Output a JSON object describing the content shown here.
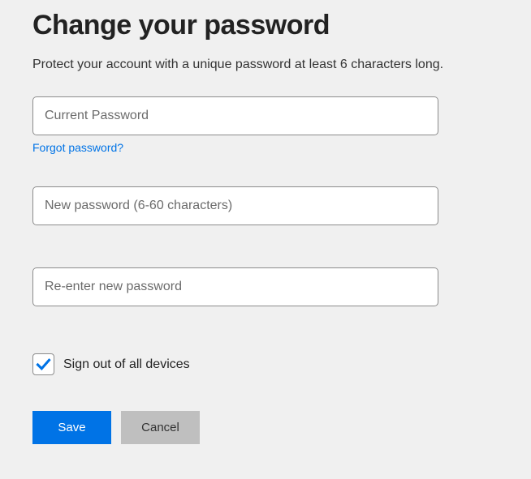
{
  "header": {
    "title": "Change your password",
    "subtitle": "Protect your account with a unique password at least 6 characters long."
  },
  "form": {
    "current_password": {
      "placeholder": "Current Password",
      "value": ""
    },
    "forgot_link": "Forgot password?",
    "new_password": {
      "placeholder": "New password (6-60 characters)",
      "value": ""
    },
    "confirm_password": {
      "placeholder": "Re-enter new password",
      "value": ""
    },
    "signout_checkbox": {
      "label": "Sign out of all devices",
      "checked": true
    }
  },
  "buttons": {
    "save": "Save",
    "cancel": "Cancel"
  }
}
